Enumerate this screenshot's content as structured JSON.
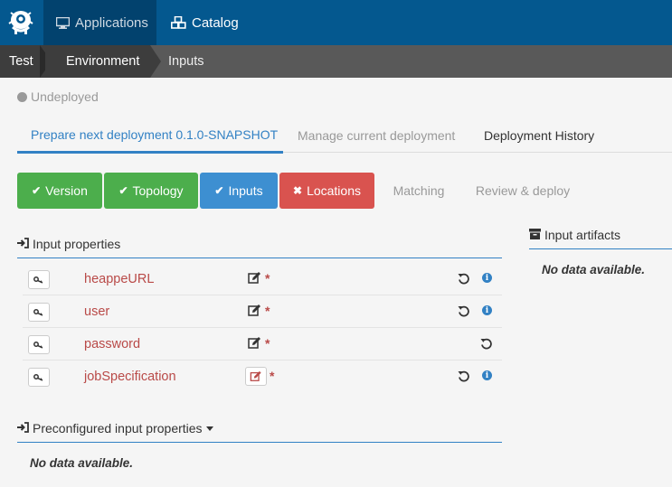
{
  "topnav": {
    "applications_label": "Applications",
    "catalog_label": "Catalog"
  },
  "breadcrumb": {
    "items": [
      "Test",
      "Environment",
      "Inputs"
    ]
  },
  "status": {
    "label": "Undeployed",
    "color": "#999999"
  },
  "deployment_tabs": {
    "prepare": "Prepare next deployment 0.1.0-SNAPSHOT",
    "manage": "Manage current deployment",
    "history": "Deployment History"
  },
  "steps": {
    "version": "Version",
    "topology": "Topology",
    "inputs": "Inputs",
    "locations": "Locations",
    "matching": "Matching",
    "review": "Review & deploy",
    "colors": {
      "done": "#4cae4c",
      "current": "#3d8fd1",
      "error": "#d9534f"
    }
  },
  "input_properties": {
    "title": "Input properties",
    "rows": [
      {
        "name": "heappeURL",
        "required": "*"
      },
      {
        "name": "user",
        "required": "*"
      },
      {
        "name": "password",
        "required": "*"
      },
      {
        "name": "jobSpecification",
        "required": "*"
      }
    ]
  },
  "preconfigured": {
    "title": "Preconfigured input properties",
    "no_data": "No data available."
  },
  "input_artifacts": {
    "title": "Input artifacts",
    "no_data": "No data available."
  },
  "icons": {
    "logo": "alien-logo-icon",
    "applications": "desktop-icon",
    "catalog": "cubes-icon",
    "key": "key-icon",
    "edit": "edit-icon",
    "reset": "undo-icon",
    "info": "info-icon",
    "sign_in": "sign-in-icon",
    "archive": "archive-icon"
  }
}
